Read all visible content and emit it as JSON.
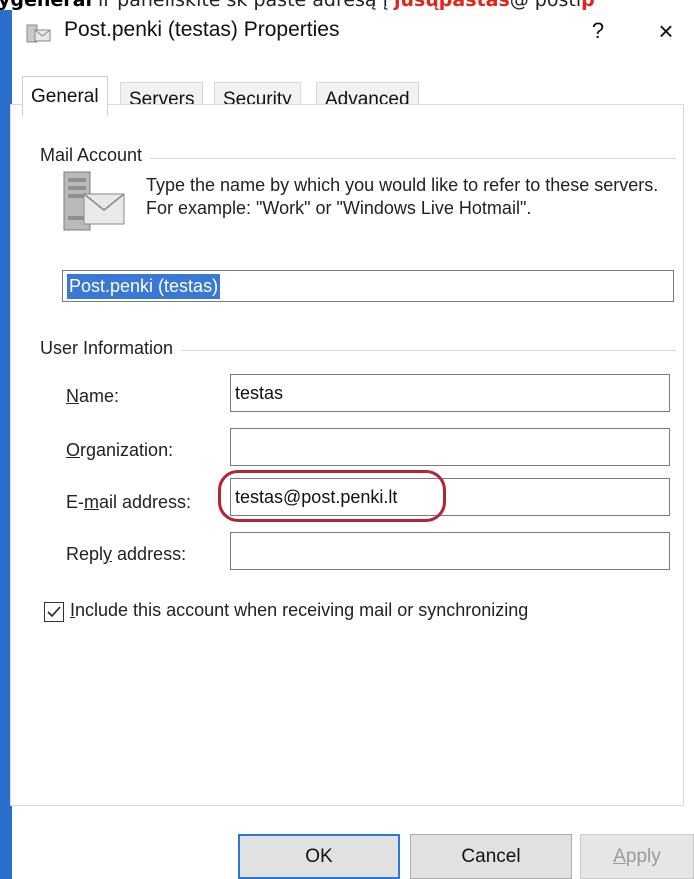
{
  "top_strip": {
    "bold": "ygeneral",
    "text1": " ir paneliskite sk paste adresą į ",
    "red1": "jūsųpaštas",
    "text2": "@ posti",
    "red2": "p"
  },
  "window": {
    "title": "Post.penki (testas) Properties",
    "help": "?",
    "close": "×"
  },
  "tabs": [
    "General",
    "Servers",
    "Security",
    "Advanced"
  ],
  "mail_account": {
    "group_label": "Mail Account",
    "description": "Type the name by which you would like to refer to these servers.  For example: \"Work\" or \"Windows Live Hotmail\".",
    "account_name": "Post.penki (testas)"
  },
  "user_info": {
    "group_label": "User Information",
    "name_label_u": "N",
    "name_label_rest": "ame:",
    "name_value": "testas",
    "org_label_u": "O",
    "org_label_rest": "rganization:",
    "org_value": "",
    "email_label_pre": "E-",
    "email_label_u": "m",
    "email_label_rest": "ail address:",
    "email_value": "testas@post.penki.lt",
    "reply_label_pre": "Repl",
    "reply_label_u": "y",
    "reply_label_rest": " address:",
    "reply_value": ""
  },
  "include": {
    "checked": true,
    "label_u": "I",
    "label_rest": "nclude this account when receiving mail or synchronizing"
  },
  "buttons": {
    "ok": "OK",
    "cancel": "Cancel",
    "apply_u": "A",
    "apply_rest": "pply"
  },
  "colors": {
    "window_accent": "#2a6fcc",
    "selection": "#3a78d6",
    "highlight_oval": "#b3243a",
    "annotation_red": "#e0261c"
  }
}
